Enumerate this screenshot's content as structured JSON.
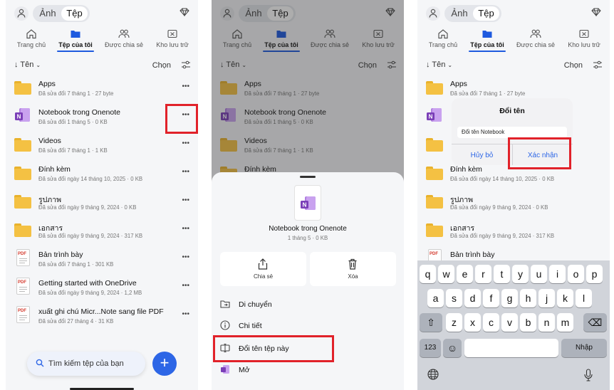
{
  "top": {
    "seg_photos": "Ảnh",
    "seg_files": "Tệp"
  },
  "tabs": [
    "Trang chủ",
    "Tệp của tôi",
    "Được chia sẻ",
    "Kho lưu trữ"
  ],
  "sort": {
    "label": "Tên",
    "select": "Chọn"
  },
  "files": [
    {
      "name": "Apps",
      "meta": "Đã sửa đổi 7 tháng 1 · 27 byte",
      "type": "folder"
    },
    {
      "name": "Notebook trong Onenote",
      "meta": "Đã sửa đổi 1 tháng 5 · 0 KB",
      "type": "onenote"
    },
    {
      "name": "Videos",
      "meta": "Đã sửa đổi 7 tháng 1 · 1 KB",
      "type": "folder"
    },
    {
      "name": "Đính kèm",
      "meta": "Đã sửa đổi ngày 14 tháng 10, 2025 · 0 KB",
      "type": "folder"
    },
    {
      "name": "รูปภาพ",
      "meta": "Đã sửa đổi ngày 9 tháng 9, 2024 · 0 KB",
      "type": "folder"
    },
    {
      "name": "เอกสาร",
      "meta": "Đã sửa đổi ngày 9 tháng 9, 2024 · 317 KB",
      "type": "folder"
    },
    {
      "name": "Bản trình bày",
      "meta": "Đã sửa đổi 7 tháng 1 · 301 KB",
      "type": "pdf"
    },
    {
      "name": "Getting started with OneDrive",
      "meta": "Đã sửa đổi ngày 9 tháng 9, 2024 · 1,2 MB",
      "type": "pdf"
    },
    {
      "name": "xuất ghi chú Micr...Note sang file PDF",
      "meta": "Đã sửa đổi 27 tháng 4 · 31 KB",
      "type": "pdf"
    }
  ],
  "search_placeholder": "Tìm kiếm tệp của bạn",
  "sheet": {
    "name": "Notebook trong Onenote",
    "meta": "1 tháng 5 · 0 KB",
    "share": "Chia sẻ",
    "delete": "Xóa",
    "menu": [
      "Di chuyển",
      "Chi tiết",
      "Đổi tên tệp này",
      "Mở"
    ]
  },
  "dialog": {
    "title": "Đổi tên",
    "value": "Đổi tên Notebook",
    "cancel": "Hủy bỏ",
    "confirm": "Xác nhận"
  },
  "keyboard": {
    "row1": [
      "q",
      "w",
      "e",
      "r",
      "t",
      "y",
      "u",
      "i",
      "o",
      "p"
    ],
    "row2": [
      "a",
      "s",
      "d",
      "f",
      "g",
      "h",
      "j",
      "k",
      "l"
    ],
    "row3": [
      "z",
      "x",
      "c",
      "v",
      "b",
      "n",
      "m"
    ],
    "num": "123",
    "enter": "Nhập"
  },
  "colors": {
    "accent": "#2d66e6",
    "highlight": "#e1222a",
    "folder": "#f4c143",
    "onenote": "#7b3fb8"
  }
}
